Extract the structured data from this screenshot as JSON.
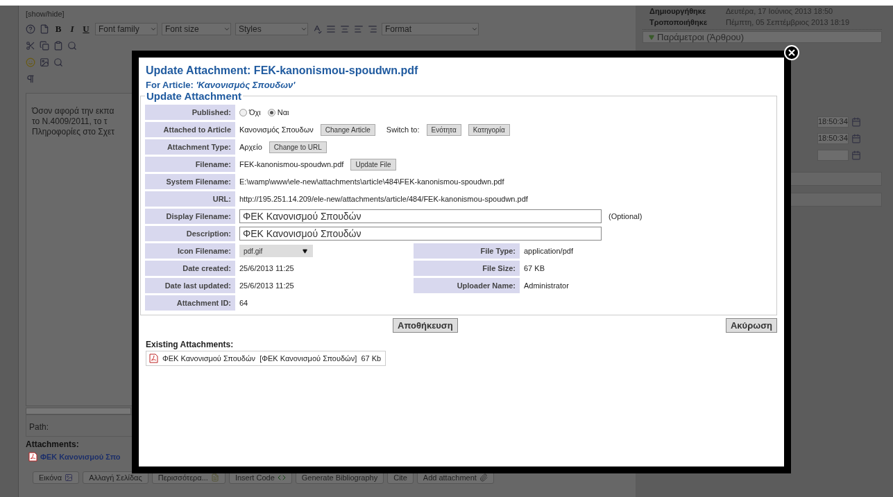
{
  "background": {
    "editor": {
      "toggle": "[show/hide]",
      "format_buttons": [
        "B",
        "I",
        "U"
      ],
      "dropdowns": [
        "Font family",
        "Font size",
        "Styles",
        "Format"
      ],
      "lines": [
        "Όσον αφορά την εκπα",
        "το Ν.4009/2011, το τ",
        "Πληροφορίες στο Σχετ"
      ],
      "path_label": "Path:",
      "attachments_heading": "Attachments:",
      "attachment_link": "ΦΕΚ Κανονισμού Σπο",
      "buttons": [
        {
          "label": "Εικόνα",
          "kind": "image"
        },
        {
          "label": "Αλλαγή Σελίδας",
          "kind": "plain"
        },
        {
          "label": "Περισσότερα...",
          "kind": "more"
        },
        {
          "label": "Insert Code",
          "kind": "code"
        },
        {
          "label": "Generate Bibliography",
          "kind": "plain"
        },
        {
          "label": "Cite",
          "kind": "plain"
        },
        {
          "label": "Add attachment",
          "kind": "attach"
        }
      ]
    },
    "info": [
      {
        "label": "Δημιουργήθηκε",
        "value": "Δευτέρα, 17 Ιούνιος 2013 18:50"
      },
      {
        "label": "Τροποποιήθηκε",
        "value": "Πέμπτη, 05 Σεπτέμβριος 2013 18:19"
      }
    ],
    "params_heading": "Παράμετροι (Άρθρου)",
    "time_fields": [
      "18:50:34",
      "18:50:34"
    ]
  },
  "modal": {
    "title": "Update Attachment: FEK-kanonismou-spoudwn.pdf",
    "subtitle_label": "For Article:",
    "subtitle_article": "'Κανονισμός Σπουδων'",
    "legend": "Update Attachment",
    "rows": [
      {
        "kind": "radio",
        "label": "Published:",
        "options": [
          {
            "label": "Όχι",
            "selected": false
          },
          {
            "label": "Ναι",
            "selected": true
          }
        ]
      },
      {
        "kind": "article",
        "label": "Attached to Article",
        "value": "Κανονισμός Σπουδων",
        "button": "Change Article",
        "switch_label": "Switch to:",
        "switch_buttons": [
          "Ενότητα",
          "Κατηγορία"
        ]
      },
      {
        "kind": "text_button",
        "label": "Attachment Type:",
        "value": "Αρχείο",
        "button": "Change to URL"
      },
      {
        "kind": "text_button",
        "label": "Filename:",
        "value": "FEK-kanonismou-spoudwn.pdf",
        "button": "Update File"
      },
      {
        "kind": "text",
        "label": "System Filename:",
        "value": "E:\\wamp\\www\\ele-new\\attachments\\article\\484\\FEK-kanonismou-spoudwn.pdf"
      },
      {
        "kind": "text",
        "label": "URL:",
        "value": "http://195.251.14.209/ele-new/attachments/article/484/FEK-kanonismou-spoudwn.pdf"
      },
      {
        "kind": "input",
        "label": "Display Filename:",
        "value": "ΦΕΚ Κανονισμού Σπουδών",
        "note": "(Optional)"
      },
      {
        "kind": "input",
        "label": "Description:",
        "value": "ΦΕΚ Κανονισμού Σπουδών"
      }
    ],
    "left_details": [
      {
        "kind": "select",
        "label": "Icon Filename:",
        "value": "pdf.gif"
      },
      {
        "kind": "text",
        "label": "Date created:",
        "value": "25/6/2013 11:25"
      },
      {
        "kind": "text",
        "label": "Date last updated:",
        "value": "25/6/2013 11:25"
      },
      {
        "kind": "text",
        "label": "Attachment ID:",
        "value": "64"
      }
    ],
    "right_details": [
      {
        "label": "File Type:",
        "value": "application/pdf"
      },
      {
        "label": "File Size:",
        "value": "67 KB"
      },
      {
        "label": "Uploader Name:",
        "value": "Administrator"
      }
    ],
    "save_button": "Αποθήκευση",
    "cancel_button": "Ακύρωση",
    "existing_heading": "Existing Attachments:",
    "existing": [
      {
        "name": "ΦΕΚ Κανονισμού Σπουδών",
        "display": "[ΦΕΚ Κανονισμού Σπουδών]",
        "size": "67 Kb"
      }
    ]
  }
}
